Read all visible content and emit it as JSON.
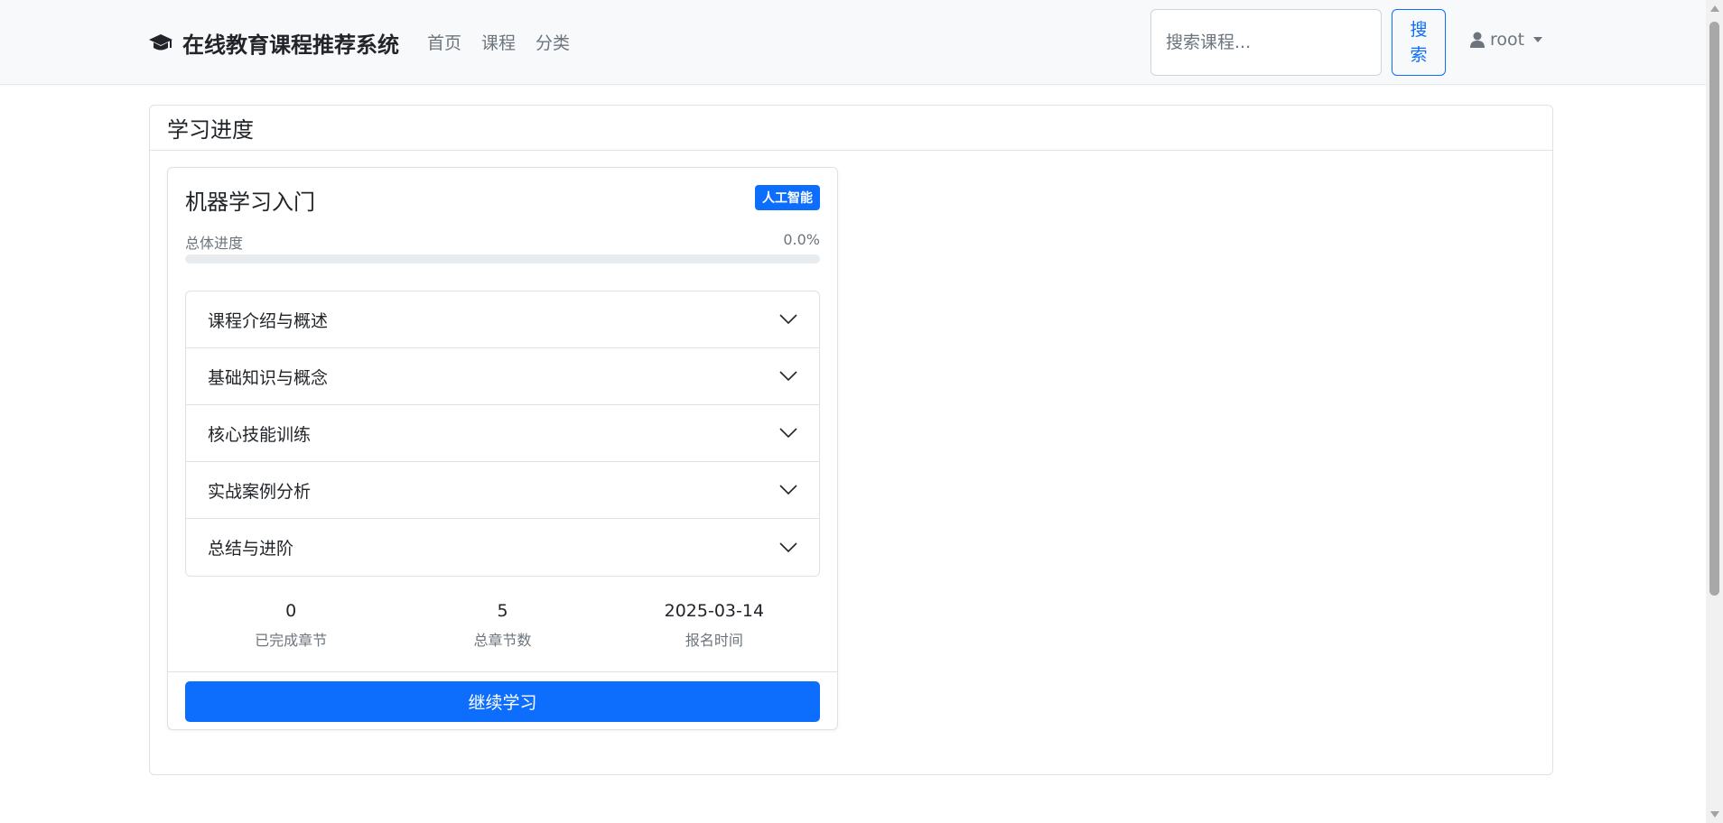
{
  "navbar": {
    "brand": "在线教育课程推荐系统",
    "brand_icon": "graduation-cap-icon",
    "links": [
      "首页",
      "课程",
      "分类"
    ],
    "search": {
      "placeholder": "搜索课程...",
      "button_label": "搜\n索"
    },
    "user": {
      "name": "root",
      "icon": "user-icon"
    }
  },
  "page": {
    "title": "学习进度"
  },
  "course": {
    "title": "机器学习入门",
    "category_badge": "人工智能",
    "progress_label": "总体进度",
    "progress_text": "0.0%",
    "progress_fraction": 0,
    "chapters": [
      "课程介绍与概述",
      "基础知识与概念",
      "核心技能训练",
      "实战案例分析",
      "总结与进阶"
    ],
    "stats": [
      {
        "value": "0",
        "label": "已完成章节"
      },
      {
        "value": "5",
        "label": "总章节数"
      },
      {
        "value": "2025-03-14",
        "label": "报名时间"
      }
    ],
    "continue_label": "继续学习"
  },
  "colors": {
    "primary": "#0d6efd",
    "navbar_bg": "#f8f9fa",
    "muted": "#6c757d"
  }
}
